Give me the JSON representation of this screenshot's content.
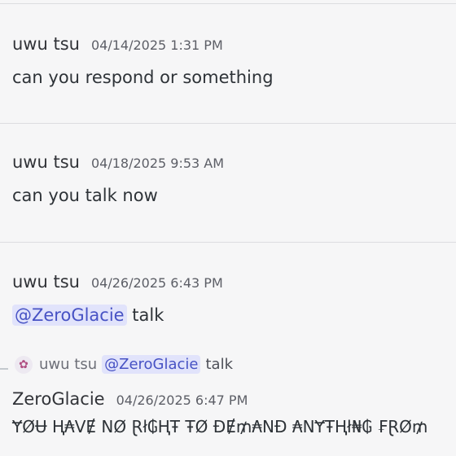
{
  "messages": [
    {
      "author": "uwu tsu",
      "timestamp": "04/14/2025 1:31 PM",
      "text": "can you respond or something"
    },
    {
      "author": "uwu tsu",
      "timestamp": "04/18/2025 9:53 AM",
      "text": "can you talk now"
    },
    {
      "author": "uwu tsu",
      "timestamp": "04/26/2025 6:43 PM",
      "mention": "@ZeroGlacie",
      "text": " talk"
    }
  ],
  "reply": {
    "referenced_author": "uwu tsu",
    "referenced_mention": "@ZeroGlacie",
    "referenced_text": "talk",
    "author": "ZeroGlacie",
    "timestamp": "04/26/2025 6:47 PM",
    "text": "ɎØɄ Ⱨ₳VɆ NØ Ɽł₲ⱧŦ ŦØ ĐɆ₥₳NĐ ₳NɎŦⱧł₦₲ ₣ⱤØ₥"
  },
  "icons": {
    "reply_avatar": "user-avatar-icon"
  },
  "colors": {
    "background": "#f6f6f7",
    "mention_bg": "#e1e3fb",
    "mention_text": "#4752c4",
    "divider": "#dcdde0"
  }
}
